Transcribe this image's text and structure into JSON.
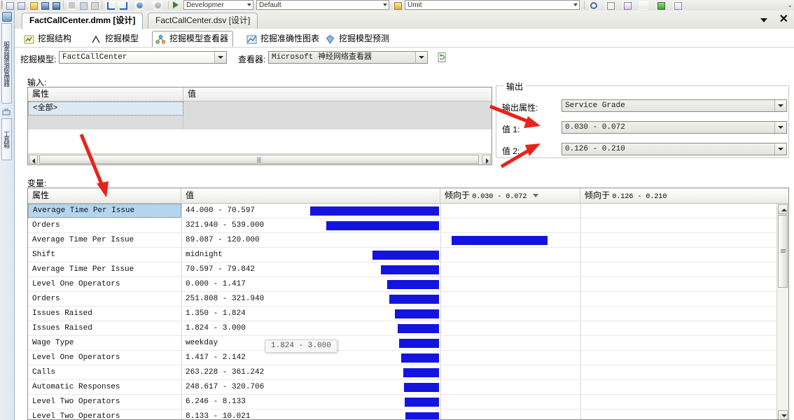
{
  "toolbar": {
    "combos": [
      {
        "name": "solution-config",
        "value": "Developmer"
      },
      {
        "name": "solution-platform",
        "value": "Default"
      },
      {
        "name": "unit-combo",
        "value": "Umit"
      }
    ],
    "overflow_glyph": "⌄"
  },
  "dock": {
    "tabs": [
      {
        "label": "服务器资源管理器",
        "icon": "server-explorer-icon"
      },
      {
        "label": "工具箱",
        "icon": "toolbox-icon"
      }
    ]
  },
  "document_tabs": [
    {
      "label": "FactCallCenter.dmm [设计]",
      "active": true
    },
    {
      "label": "FactCallCenter.dsv [设计]",
      "active": false
    }
  ],
  "window_controls": {
    "dropdown_icon": "chevron-down-icon",
    "close_icon": "close-icon"
  },
  "designer_tabs": [
    {
      "label": "挖掘结构",
      "icon": "mining-structure-icon",
      "selected": false
    },
    {
      "label": "挖掘模型",
      "icon": "mining-model-icon",
      "selected": false
    },
    {
      "label": "挖掘模型查看器",
      "icon": "mining-model-viewer-icon",
      "selected": true
    },
    {
      "label": "挖掘准确性图表",
      "icon": "accuracy-chart-icon",
      "selected": false
    },
    {
      "label": "挖掘模型预测",
      "icon": "prediction-icon",
      "selected": false
    }
  ],
  "selectors": {
    "model_label": "挖掘模型:",
    "model_value": "FactCallCenter",
    "viewer_label": "查看器:",
    "viewer_value": "Microsoft 神经网络查看器",
    "refresh_icon": "refresh-document-icon"
  },
  "input_panel": {
    "title": "输入:",
    "columns": [
      "属性",
      "值"
    ],
    "rows": [
      {
        "attribute": "<全部>",
        "value": "",
        "selected": true
      },
      {
        "attribute": "",
        "value": "",
        "selected": false
      }
    ]
  },
  "output_panel": {
    "title": "输出",
    "fields": [
      {
        "label": "输出属性:",
        "value": "Service Grade",
        "name": "output-attribute-combo"
      },
      {
        "label": "值 1:",
        "value": "0.030 - 0.072",
        "name": "value1-combo"
      },
      {
        "label": "值 2:",
        "value": "0.126 - 0.210",
        "name": "value2-combo"
      }
    ]
  },
  "variables_panel": {
    "title": "变量:",
    "columns": [
      {
        "label": "属性"
      },
      {
        "label": "值"
      },
      {
        "label": "倾向于",
        "range": "0.030 - 0.072",
        "sorted": true
      },
      {
        "label": "倾向于",
        "range": "0.126 - 0.210",
        "sorted": false
      }
    ],
    "rows": [
      {
        "attribute": "Average Time Per Issue",
        "value": "44.000 - 70.597",
        "bar1": 184,
        "bar2": 0,
        "selected": true
      },
      {
        "attribute": "Orders",
        "value": "321.940 - 539.000",
        "bar1": 161,
        "bar2": 0,
        "selected": false
      },
      {
        "attribute": "Average Time Per Issue",
        "value": "89.087 - 120.000",
        "bar1": 0,
        "bar2": 137,
        "selected": false
      },
      {
        "attribute": "Shift",
        "value": "midnight",
        "bar1": 95,
        "bar2": 0,
        "selected": false
      },
      {
        "attribute": "Average Time Per Issue",
        "value": "70.597 - 79.842",
        "bar1": 83,
        "bar2": 0,
        "selected": false
      },
      {
        "attribute": "Level One Operators",
        "value": "0.000 - 1.417",
        "bar1": 74,
        "bar2": 0,
        "selected": false
      },
      {
        "attribute": "Orders",
        "value": "251.808 - 321.940",
        "bar1": 71,
        "bar2": 0,
        "selected": false
      },
      {
        "attribute": "Issues Raised",
        "value": "1.350 - 1.824",
        "bar1": 63,
        "bar2": 0,
        "selected": false
      },
      {
        "attribute": "Issues Raised",
        "value": "1.824 - 3.000",
        "bar1": 59,
        "bar2": 0,
        "selected": false
      },
      {
        "attribute": "Wage Type",
        "value": "weekday",
        "bar1": 57,
        "bar2": 0,
        "selected": false
      },
      {
        "attribute": "Level One Operators",
        "value": "1.417 - 2.142",
        "bar1": 54,
        "bar2": 0,
        "selected": false
      },
      {
        "attribute": "Calls",
        "value": "263.228 - 361.242",
        "bar1": 51,
        "bar2": 0,
        "selected": false
      },
      {
        "attribute": "Automatic Responses",
        "value": "248.617 - 320.706",
        "bar1": 50,
        "bar2": 0,
        "selected": false
      },
      {
        "attribute": "Level Two Operators",
        "value": "6.246 - 8.133",
        "bar1": 49,
        "bar2": 0,
        "selected": false
      },
      {
        "attribute": "Level Two Operators",
        "value": "8.133 - 10.021",
        "bar1": 48,
        "bar2": 0,
        "selected": false
      }
    ]
  },
  "tooltip": {
    "text": "1.824 - 3.000"
  },
  "colors": {
    "bar": "#1414e0",
    "selection": "#b3d5f0",
    "annotation": "#e8231a"
  }
}
